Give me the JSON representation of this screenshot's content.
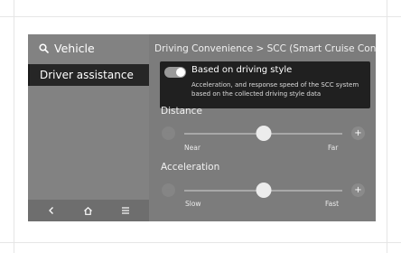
{
  "search": {
    "label": "Vehicle"
  },
  "sidebar": {
    "active_item": "Driver assistance",
    "bottom_icons": [
      "back-icon",
      "home-icon",
      "menu-icon"
    ]
  },
  "breadcrumb": "Driving Convenience > SCC (Smart Cruise Control)",
  "popup": {
    "toggle_on": true,
    "title": "Based on driving style",
    "description": "Acceleration, and response speed of the SCC system based on the collected driving style data"
  },
  "distance": {
    "label": "Distance",
    "min_label": "Near",
    "max_label": "Far",
    "level": 0.5
  },
  "acceleration": {
    "label": "Acceleration",
    "min_label": "Slow",
    "max_label": "Fast",
    "level": 0.5
  },
  "colors": {
    "screen_bg": "#7c7c7c",
    "popup_bg": "#202020",
    "active_item_bg": "#262626"
  }
}
